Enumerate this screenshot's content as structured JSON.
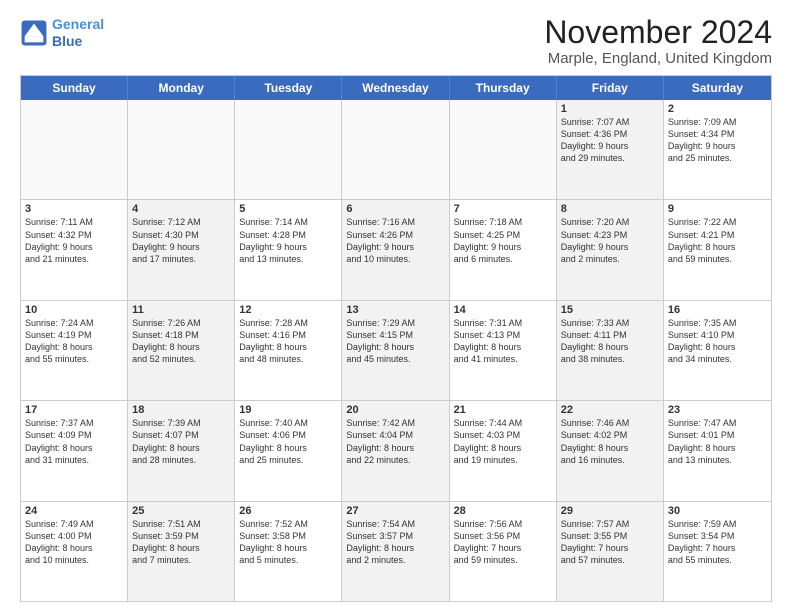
{
  "logo": {
    "line1": "General",
    "line2": "Blue"
  },
  "title": "November 2024",
  "location": "Marple, England, United Kingdom",
  "header_days": [
    "Sunday",
    "Monday",
    "Tuesday",
    "Wednesday",
    "Thursday",
    "Friday",
    "Saturday"
  ],
  "rows": [
    [
      {
        "day": "",
        "info": "",
        "shaded": false,
        "empty": true
      },
      {
        "day": "",
        "info": "",
        "shaded": false,
        "empty": true
      },
      {
        "day": "",
        "info": "",
        "shaded": false,
        "empty": true
      },
      {
        "day": "",
        "info": "",
        "shaded": false,
        "empty": true
      },
      {
        "day": "",
        "info": "",
        "shaded": false,
        "empty": true
      },
      {
        "day": "1",
        "info": "Sunrise: 7:07 AM\nSunset: 4:36 PM\nDaylight: 9 hours\nand 29 minutes.",
        "shaded": true,
        "empty": false
      },
      {
        "day": "2",
        "info": "Sunrise: 7:09 AM\nSunset: 4:34 PM\nDaylight: 9 hours\nand 25 minutes.",
        "shaded": false,
        "empty": false
      }
    ],
    [
      {
        "day": "3",
        "info": "Sunrise: 7:11 AM\nSunset: 4:32 PM\nDaylight: 9 hours\nand 21 minutes.",
        "shaded": false,
        "empty": false
      },
      {
        "day": "4",
        "info": "Sunrise: 7:12 AM\nSunset: 4:30 PM\nDaylight: 9 hours\nand 17 minutes.",
        "shaded": true,
        "empty": false
      },
      {
        "day": "5",
        "info": "Sunrise: 7:14 AM\nSunset: 4:28 PM\nDaylight: 9 hours\nand 13 minutes.",
        "shaded": false,
        "empty": false
      },
      {
        "day": "6",
        "info": "Sunrise: 7:16 AM\nSunset: 4:26 PM\nDaylight: 9 hours\nand 10 minutes.",
        "shaded": true,
        "empty": false
      },
      {
        "day": "7",
        "info": "Sunrise: 7:18 AM\nSunset: 4:25 PM\nDaylight: 9 hours\nand 6 minutes.",
        "shaded": false,
        "empty": false
      },
      {
        "day": "8",
        "info": "Sunrise: 7:20 AM\nSunset: 4:23 PM\nDaylight: 9 hours\nand 2 minutes.",
        "shaded": true,
        "empty": false
      },
      {
        "day": "9",
        "info": "Sunrise: 7:22 AM\nSunset: 4:21 PM\nDaylight: 8 hours\nand 59 minutes.",
        "shaded": false,
        "empty": false
      }
    ],
    [
      {
        "day": "10",
        "info": "Sunrise: 7:24 AM\nSunset: 4:19 PM\nDaylight: 8 hours\nand 55 minutes.",
        "shaded": false,
        "empty": false
      },
      {
        "day": "11",
        "info": "Sunrise: 7:26 AM\nSunset: 4:18 PM\nDaylight: 8 hours\nand 52 minutes.",
        "shaded": true,
        "empty": false
      },
      {
        "day": "12",
        "info": "Sunrise: 7:28 AM\nSunset: 4:16 PM\nDaylight: 8 hours\nand 48 minutes.",
        "shaded": false,
        "empty": false
      },
      {
        "day": "13",
        "info": "Sunrise: 7:29 AM\nSunset: 4:15 PM\nDaylight: 8 hours\nand 45 minutes.",
        "shaded": true,
        "empty": false
      },
      {
        "day": "14",
        "info": "Sunrise: 7:31 AM\nSunset: 4:13 PM\nDaylight: 8 hours\nand 41 minutes.",
        "shaded": false,
        "empty": false
      },
      {
        "day": "15",
        "info": "Sunrise: 7:33 AM\nSunset: 4:11 PM\nDaylight: 8 hours\nand 38 minutes.",
        "shaded": true,
        "empty": false
      },
      {
        "day": "16",
        "info": "Sunrise: 7:35 AM\nSunset: 4:10 PM\nDaylight: 8 hours\nand 34 minutes.",
        "shaded": false,
        "empty": false
      }
    ],
    [
      {
        "day": "17",
        "info": "Sunrise: 7:37 AM\nSunset: 4:09 PM\nDaylight: 8 hours\nand 31 minutes.",
        "shaded": false,
        "empty": false
      },
      {
        "day": "18",
        "info": "Sunrise: 7:39 AM\nSunset: 4:07 PM\nDaylight: 8 hours\nand 28 minutes.",
        "shaded": true,
        "empty": false
      },
      {
        "day": "19",
        "info": "Sunrise: 7:40 AM\nSunset: 4:06 PM\nDaylight: 8 hours\nand 25 minutes.",
        "shaded": false,
        "empty": false
      },
      {
        "day": "20",
        "info": "Sunrise: 7:42 AM\nSunset: 4:04 PM\nDaylight: 8 hours\nand 22 minutes.",
        "shaded": true,
        "empty": false
      },
      {
        "day": "21",
        "info": "Sunrise: 7:44 AM\nSunset: 4:03 PM\nDaylight: 8 hours\nand 19 minutes.",
        "shaded": false,
        "empty": false
      },
      {
        "day": "22",
        "info": "Sunrise: 7:46 AM\nSunset: 4:02 PM\nDaylight: 8 hours\nand 16 minutes.",
        "shaded": true,
        "empty": false
      },
      {
        "day": "23",
        "info": "Sunrise: 7:47 AM\nSunset: 4:01 PM\nDaylight: 8 hours\nand 13 minutes.",
        "shaded": false,
        "empty": false
      }
    ],
    [
      {
        "day": "24",
        "info": "Sunrise: 7:49 AM\nSunset: 4:00 PM\nDaylight: 8 hours\nand 10 minutes.",
        "shaded": false,
        "empty": false
      },
      {
        "day": "25",
        "info": "Sunrise: 7:51 AM\nSunset: 3:59 PM\nDaylight: 8 hours\nand 7 minutes.",
        "shaded": true,
        "empty": false
      },
      {
        "day": "26",
        "info": "Sunrise: 7:52 AM\nSunset: 3:58 PM\nDaylight: 8 hours\nand 5 minutes.",
        "shaded": false,
        "empty": false
      },
      {
        "day": "27",
        "info": "Sunrise: 7:54 AM\nSunset: 3:57 PM\nDaylight: 8 hours\nand 2 minutes.",
        "shaded": true,
        "empty": false
      },
      {
        "day": "28",
        "info": "Sunrise: 7:56 AM\nSunset: 3:56 PM\nDaylight: 7 hours\nand 59 minutes.",
        "shaded": false,
        "empty": false
      },
      {
        "day": "29",
        "info": "Sunrise: 7:57 AM\nSunset: 3:55 PM\nDaylight: 7 hours\nand 57 minutes.",
        "shaded": true,
        "empty": false
      },
      {
        "day": "30",
        "info": "Sunrise: 7:59 AM\nSunset: 3:54 PM\nDaylight: 7 hours\nand 55 minutes.",
        "shaded": false,
        "empty": false
      }
    ]
  ]
}
